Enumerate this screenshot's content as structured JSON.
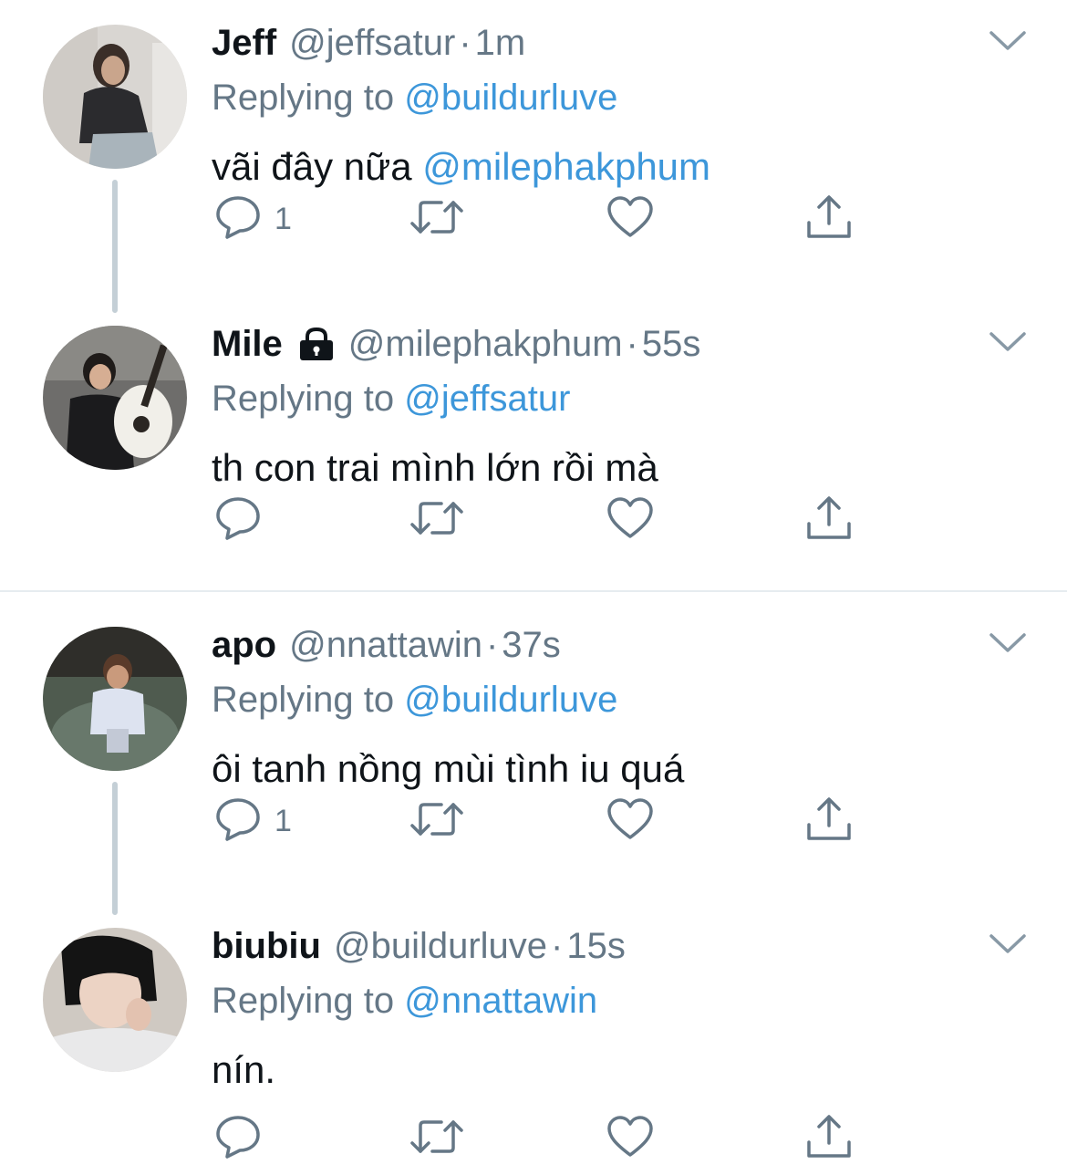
{
  "colors": {
    "link": "#3d97da",
    "secondary_text": "#657786",
    "primary_text": "#0f1419",
    "thread_line": "#c4cfd6",
    "divider": "#e6ecf0"
  },
  "icons": {
    "reply": "speech-bubble-icon",
    "retweet": "retweet-arrows-icon",
    "like": "heart-icon",
    "share": "share-upload-icon",
    "more": "chevron-down-icon",
    "protected": "lock-icon"
  },
  "tweets": [
    {
      "name": "Jeff",
      "handle": "@jeffsatur",
      "separator": "·",
      "time": "1m",
      "replying_prefix": "Replying to",
      "replying_to": "@buildurluve",
      "text": "vãi đây nữa",
      "text_mention": "@milephakphum",
      "reply_count": "1",
      "protected": false
    },
    {
      "name": "Mile",
      "handle": "@milephakphum",
      "separator": "·",
      "time": "55s",
      "replying_prefix": "Replying to",
      "replying_to": "@jeffsatur",
      "text": "th con trai mình lớn rồi mà",
      "text_mention": "",
      "reply_count": "",
      "protected": true
    },
    {
      "name": "apo",
      "handle": "@nnattawin",
      "separator": "·",
      "time": "37s",
      "replying_prefix": "Replying to",
      "replying_to": "@buildurluve",
      "text": "ôi tanh nồng mùi tình iu quá",
      "text_mention": "",
      "reply_count": "1",
      "protected": false
    },
    {
      "name": "biubiu",
      "handle": "@buildurluve",
      "separator": "·",
      "time": "15s",
      "replying_prefix": "Replying to",
      "replying_to": "@nnattawin",
      "text": "nín.",
      "text_mention": "",
      "reply_count": "",
      "protected": false
    }
  ]
}
